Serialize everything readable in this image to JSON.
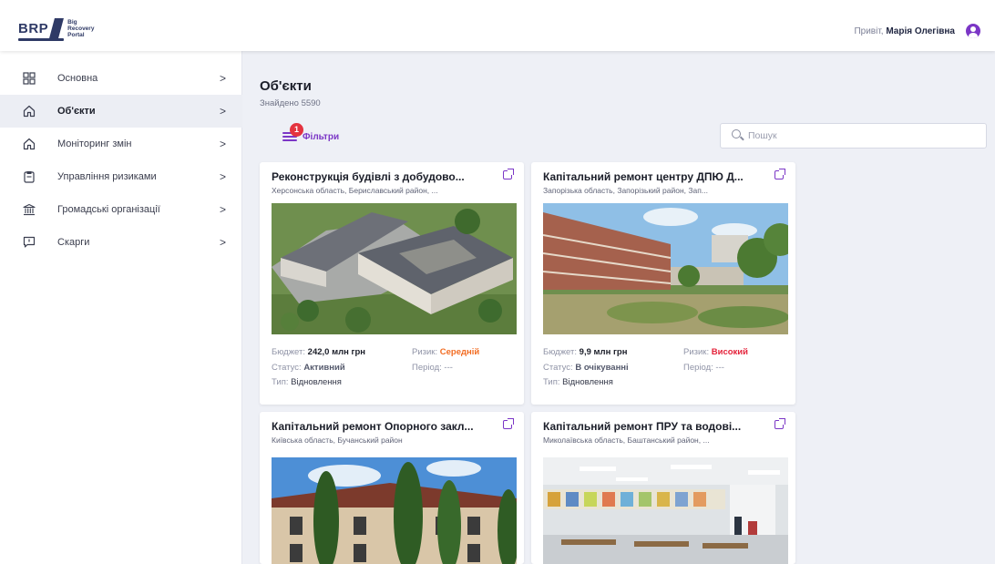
{
  "header": {
    "logo_mark": "BRP",
    "logo_line1": "Big",
    "logo_line2": "Recovery",
    "logo_line3": "Portal",
    "greeting": "Привіт,",
    "user_name": "Марія Олегівна"
  },
  "sidebar": {
    "items": [
      {
        "label": "Основна",
        "icon": "grid-icon"
      },
      {
        "label": "Об'єкти",
        "icon": "home-icon",
        "active": true
      },
      {
        "label": "Моніторинг змін",
        "icon": "home-icon"
      },
      {
        "label": "Управління ризиками",
        "icon": "clipboard-icon"
      },
      {
        "label": "Громадські організації",
        "icon": "bank-icon"
      },
      {
        "label": "Скарги",
        "icon": "comment-icon"
      }
    ],
    "chevron": ">"
  },
  "main": {
    "title": "Об'єкти",
    "found": "Знайдено 5590",
    "filter_label": "Фільтри",
    "filter_badge": "1",
    "search_placeholder": "Пошук"
  },
  "labels": {
    "budget": "Бюджет:",
    "risk": "Ризик:",
    "status": "Статус:",
    "period": "Період:",
    "type": "Тип:"
  },
  "cards": [
    {
      "title": "Реконструкція будівлі з добудово...",
      "subtitle": "Херсонська область, Бериславський район, ...",
      "budget": "242,0 млн грн",
      "risk": "Середній",
      "status": "Активний",
      "period": "---",
      "type": "Відновлення"
    },
    {
      "title": "Капітальний ремонт центру ДПЮ Д...",
      "subtitle": "Запорізька область, Запорізький район, Зап...",
      "budget": "9,9 млн грн",
      "risk": "Високий",
      "status": "В очікуванні",
      "period": "---",
      "type": "Відновлення"
    },
    {
      "title": "Капітальний ремонт Опорного закл...",
      "subtitle": "Київська область, Бучанський район"
    },
    {
      "title": "Капітальний ремонт ПРУ та водові...",
      "subtitle": "Миколаївська область, Баштанський район, ..."
    }
  ],
  "colors": {
    "accent": "#7b36c6",
    "risk_medium": "#f26c22",
    "risk_high": "#e4223a",
    "badge": "#e4333f"
  }
}
